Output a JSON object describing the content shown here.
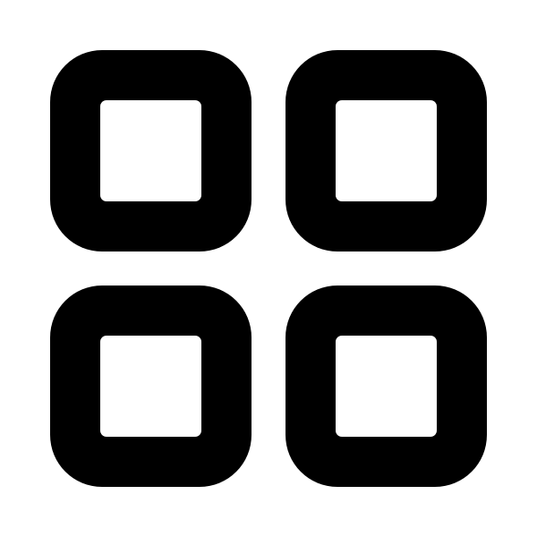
{
  "icon": {
    "name": "grid-icon",
    "foreground": "#000000",
    "background": "#ffffff",
    "tiles": [
      {
        "name": "grid-tile-top-left"
      },
      {
        "name": "grid-tile-top-right"
      },
      {
        "name": "grid-tile-bottom-left"
      },
      {
        "name": "grid-tile-bottom-right"
      }
    ]
  }
}
